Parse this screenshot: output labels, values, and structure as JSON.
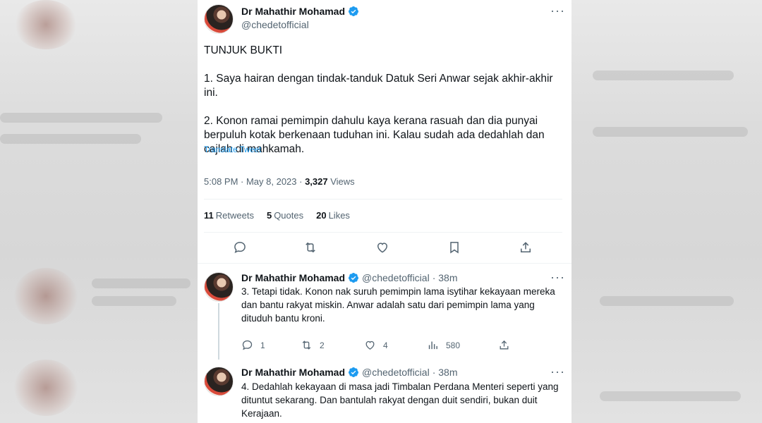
{
  "main_tweet": {
    "author_name": "Dr Mahathir Mohamad",
    "handle": "@chedetofficial",
    "text": "TUNJUK BUKTI\n\n1. Saya hairan dengan tindak-tanduk Datuk Seri Anwar sejak akhir-akhir ini.\n\n2. Konon ramai pemimpin dahulu kaya kerana rasuah dan dia punyai berpuluh kotak berkenaan tuduhan ini. Kalau sudah ada dedahlah dan cajlah di mahkamah.",
    "translate_label": "Translate Tweet",
    "timestamp": "5:08 PM · May 8, 2023 · ",
    "views_count": "3,327",
    "views_label": " Views",
    "retweets_count": "11",
    "retweets_label": "Retweets",
    "quotes_count": "5",
    "quotes_label": "Quotes",
    "likes_count": "20",
    "likes_label": "Likes"
  },
  "replies": [
    {
      "author_name": "Dr Mahathir Mohamad",
      "handle": "@chedetofficial",
      "time": "· 38m",
      "text": "3. Tetapi tidak. Konon nak suruh pemimpin lama isytihar kekayaan mereka dan bantu rakyat miskin. Anwar adalah satu dari pemimpin lama yang dituduh bantu kroni.",
      "reply_count": "1",
      "retweet_count": "2",
      "like_count": "4",
      "view_count": "580"
    },
    {
      "author_name": "Dr Mahathir Mohamad",
      "handle": "@chedetofficial",
      "time": "· 38m",
      "text": "4. Dedahlah kekayaan di masa jadi Timbalan Perdana Menteri seperti yang dituntut sekarang. Dan bantulah rakyat dengan duit sendiri, bukan duit Kerajaan."
    }
  ],
  "icons": {
    "verified": "verified-badge-icon",
    "more": "more-dots-icon",
    "reply": "reply-icon",
    "retweet": "retweet-icon",
    "like": "heart-icon",
    "bookmark": "bookmark-icon",
    "share": "share-icon",
    "views": "views-chart-icon"
  },
  "colors": {
    "accent": "#1d9bf0",
    "text": "#0f1419",
    "secondary": "#536471"
  }
}
